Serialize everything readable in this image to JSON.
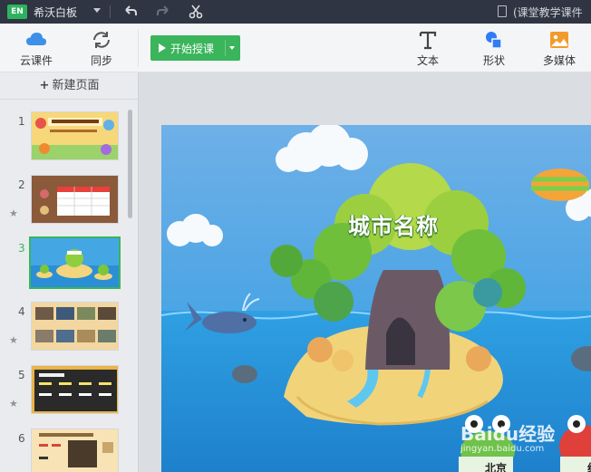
{
  "titlebar": {
    "logo_text": "EN",
    "app_name": "希沃白板",
    "doc_title": "(课堂教学课件"
  },
  "toolbar": {
    "cloud_label": "云课件",
    "sync_label": "同步",
    "start_label": "开始授课",
    "text_label": "文本",
    "shape_label": "形状",
    "media_label": "多媒体"
  },
  "sidebar": {
    "new_page_label": "新建页面",
    "pages": [
      {
        "number": "1",
        "active": false,
        "starred": false
      },
      {
        "number": "2",
        "active": false,
        "starred": true
      },
      {
        "number": "3",
        "active": true,
        "starred": false
      },
      {
        "number": "4",
        "active": false,
        "starred": true
      },
      {
        "number": "5",
        "active": false,
        "starred": true
      },
      {
        "number": "6",
        "active": false,
        "starred": false
      }
    ]
  },
  "slide": {
    "title": "城市名称",
    "label_left": "北京",
    "label_right": "纽",
    "watermark_main": "Baidu经验",
    "watermark_sub": "jingyan.baidu.com"
  },
  "colors": {
    "accent": "#3ab55c",
    "titlebar": "#2f3542",
    "sky": "#4aa9e6",
    "sea": "#2e90d8"
  }
}
